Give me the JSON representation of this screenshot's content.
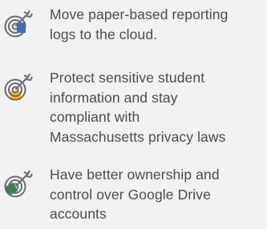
{
  "colors": {
    "text": "#4b4b52",
    "icon_stroke": "#6b6b73",
    "accent_blue": "#1a73e8",
    "accent_yellow": "#fbbc04",
    "accent_green": "#1e8e3e",
    "background": "#f2f2f2"
  },
  "goals": [
    {
      "icon": "target-arrow-icon",
      "accent": "blue",
      "lines": [
        "Move paper-based reporting",
        "logs to the cloud."
      ]
    },
    {
      "icon": "target-arrow-icon",
      "accent": "yellow",
      "lines": [
        "Protect sensitive student",
        "information and stay",
        "compliant with",
        "Massachusetts privacy laws"
      ]
    },
    {
      "icon": "target-arrow-icon",
      "accent": "green",
      "lines": [
        "Have better ownership and",
        "control over Google Drive",
        "accounts"
      ]
    }
  ]
}
